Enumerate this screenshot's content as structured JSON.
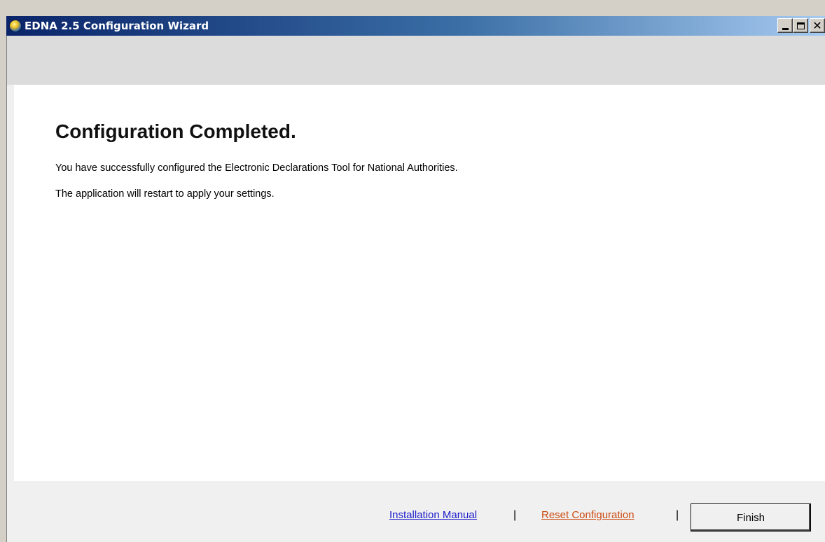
{
  "window": {
    "title": "EDNA 2.5 Configuration Wizard",
    "close_glyph": "✕"
  },
  "main": {
    "heading": "Configuration Completed.",
    "message_1": "You have successfully configured the Electronic Declarations Tool for National Authorities.",
    "message_2": "The application will restart to apply your settings."
  },
  "footer": {
    "installation_manual_label": "Installation Manual",
    "separator": "|",
    "reset_configuration_label": "Reset Configuration",
    "finish_label": "Finish"
  },
  "colors": {
    "title_gradient_start": "#0a246a",
    "title_gradient_end": "#a6caf0",
    "link_manual": "#1a1acc",
    "link_reset": "#cc4a10"
  },
  "icons": {
    "app_icon": "globe-icon",
    "minimize": "minimize-icon",
    "maximize": "maximize-icon",
    "close": "close-icon"
  }
}
